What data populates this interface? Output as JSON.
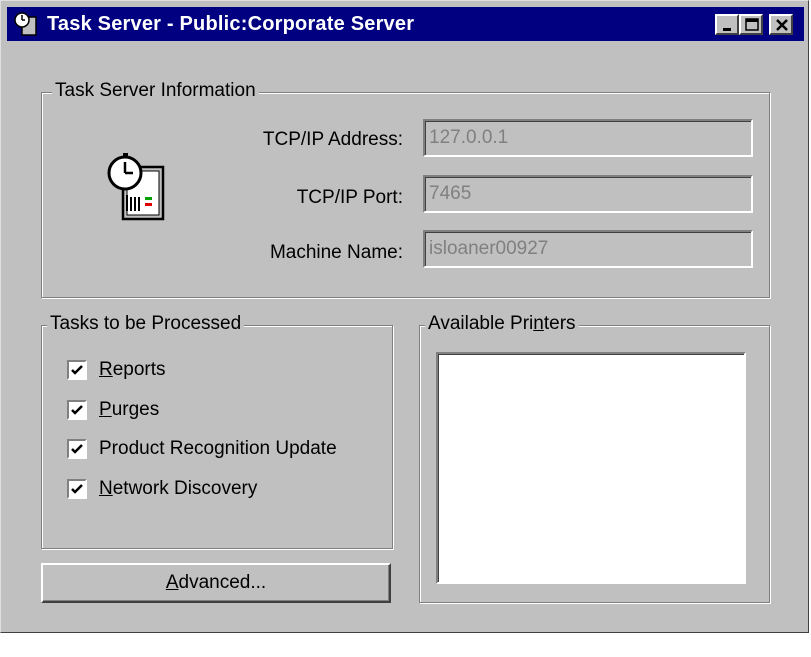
{
  "window": {
    "title": "Task Server - Public:Corporate Server",
    "controls": {
      "minimize": "minimize",
      "maximize": "maximize",
      "close": "close"
    }
  },
  "info_group": {
    "legend": "Task Server Information",
    "icon": "clock-server-icon",
    "fields": [
      {
        "label": "TCP/IP Address:",
        "value": "127.0.0.1"
      },
      {
        "label": "TCP/IP Port:",
        "value": "7465"
      },
      {
        "label": "Machine Name:",
        "value": "isloaner00927"
      }
    ]
  },
  "tasks_group": {
    "legend": "Tasks to be Processed",
    "items": [
      {
        "label_ul": "R",
        "label_rest": "eports",
        "checked": true
      },
      {
        "label_ul": "P",
        "label_rest": "urges",
        "checked": true
      },
      {
        "label_pre": "Product Recognition Update",
        "checked": true
      },
      {
        "label_ul": "N",
        "label_rest": "etwork Discovery",
        "checked": true
      }
    ]
  },
  "printers_group": {
    "legend_pre": "Available Pri",
    "legend_ul": "n",
    "legend_post": "ters",
    "items": []
  },
  "advanced_button": {
    "label_ul": "A",
    "label_rest": "dvanced..."
  },
  "colors": {
    "titlebar": "#000080",
    "face": "#c0c0c0",
    "disabled_text": "#808080"
  }
}
